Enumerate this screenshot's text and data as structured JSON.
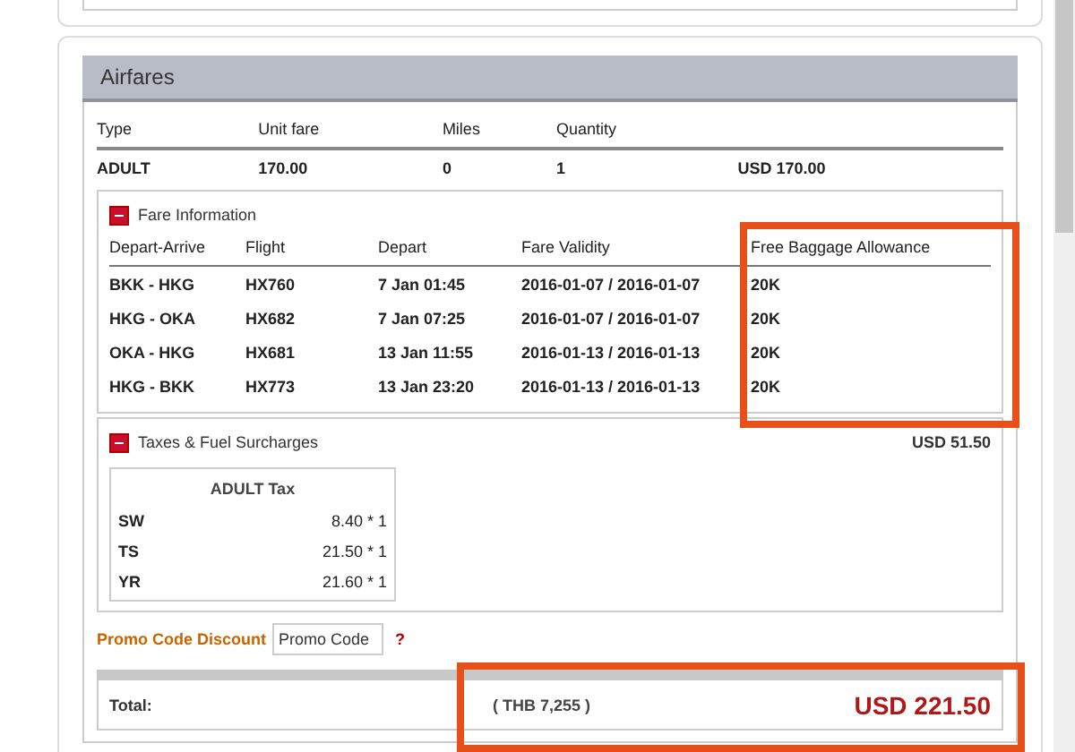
{
  "airfares": {
    "title": "Airfares",
    "columns": [
      "Type",
      "Unit fare",
      "Miles",
      "Quantity"
    ],
    "rows": [
      {
        "cells": [
          "ADULT",
          "170.00",
          "0",
          "1",
          "USD 170.00"
        ]
      }
    ],
    "fare_information": {
      "title": "Fare Information",
      "expanded": true,
      "columns": [
        {
          "label": "Depart-Arrive",
          "highlighted": false
        },
        {
          "label": "Flight",
          "highlighted": false
        },
        {
          "label": "Depart",
          "highlighted": false
        },
        {
          "label": "Fare Validity",
          "highlighted": false
        },
        {
          "label": "Free Baggage Allowance",
          "highlighted": true
        }
      ],
      "rows": [
        [
          "BKK - HKG",
          "HX760",
          "7 Jan 01:45",
          "2016-01-07 / 2016-01-07",
          "20K"
        ],
        [
          "HKG - OKA",
          "HX682",
          "7 Jan 07:25",
          "2016-01-07 / 2016-01-07",
          "20K"
        ],
        [
          "OKA - HKG",
          "HX681",
          "13 Jan 11:55",
          "2016-01-13 / 2016-01-13",
          "20K"
        ],
        [
          "HKG - BKK",
          "HX773",
          "13 Jan 23:20",
          "2016-01-13 / 2016-01-13",
          "20K"
        ]
      ]
    },
    "taxes": {
      "title": "Taxes & Fuel Surcharges",
      "expanded": true,
      "amount": "USD 51.50",
      "table_title": "ADULT Tax",
      "rows": [
        [
          "SW",
          "8.40 * 1"
        ],
        [
          "TS",
          "21.50 * 1"
        ],
        [
          "YR",
          "21.60 * 1"
        ]
      ]
    },
    "promo": {
      "label": "Promo Code Discount",
      "placeholder": "Promo Code",
      "help": "?"
    },
    "total": {
      "label": "Total:",
      "converted": "( THB 7,255 )",
      "amount": "USD 221.50",
      "highlighted": true
    }
  }
}
